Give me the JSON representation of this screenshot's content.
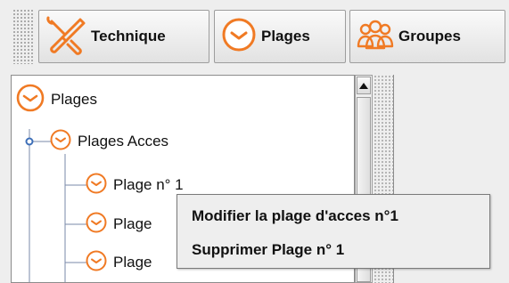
{
  "toolbar": {
    "technique_label": "Technique",
    "plages_label": "Plages",
    "groupes_label": "Groupes",
    "icons": {
      "technique": "tools-icon",
      "plages": "clock-icon",
      "groupes": "users-icon"
    },
    "accent_color": "#f07a24"
  },
  "tree": {
    "root_label": "Plages",
    "acces_label": "Plages Acces",
    "items": [
      {
        "label": "Plage n° 1"
      },
      {
        "label": "Plage"
      },
      {
        "label": "Plage"
      }
    ]
  },
  "context_menu": {
    "items": [
      {
        "label": "Modifier la plage d'acces n°1"
      },
      {
        "label": "Supprimer Plage n° 1"
      }
    ]
  }
}
